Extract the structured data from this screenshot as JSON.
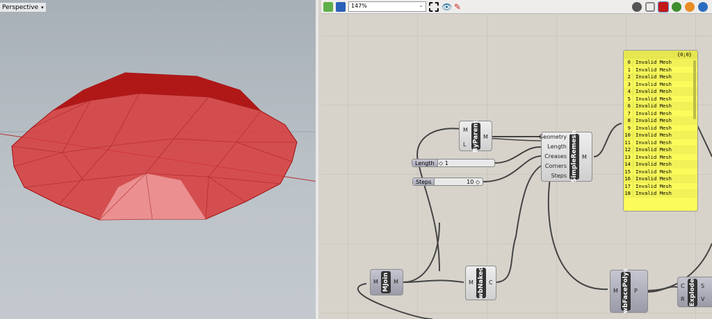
{
  "viewport": {
    "label": "Perspective",
    "mesh_color": "#d42020"
  },
  "toolbar": {
    "zoom": "147%"
  },
  "nodes": {
    "byparent": {
      "name": "ByParent",
      "inputs": [
        "M",
        "L"
      ],
      "outputs": [
        "M"
      ]
    },
    "simpleremesh": {
      "name": "SimpleRemesh",
      "inputs": [
        "Geometry",
        "Length",
        "Creases",
        "Corners",
        "Steps"
      ],
      "outputs": [
        "M"
      ]
    },
    "mjoin": {
      "name": "MJoin",
      "inputs": [
        "M"
      ],
      "outputs": [
        "M"
      ]
    },
    "wbnaked": {
      "name": "wbNaked",
      "inputs": [
        "M"
      ],
      "outputs": [
        "C"
      ]
    },
    "wbfacepolys": {
      "name": "wbFacePolys",
      "inputs": [
        "M"
      ],
      "outputs": [
        "P"
      ]
    },
    "explode": {
      "name": "Explode",
      "inputs": [
        "C",
        "R"
      ],
      "outputs": [
        "S",
        "V"
      ]
    }
  },
  "sliders": [
    {
      "label": "Length",
      "value": "◇ 1"
    },
    {
      "label": "Steps",
      "value": "10 ◇"
    }
  ],
  "panel": {
    "path": "{0;0}",
    "rows": [
      {
        "i": "0",
        "t": "Invalid Mesh"
      },
      {
        "i": "1",
        "t": "Invalid Mesh"
      },
      {
        "i": "2",
        "t": "Invalid Mesh"
      },
      {
        "i": "3",
        "t": "Invalid Mesh"
      },
      {
        "i": "4",
        "t": "Invalid Mesh"
      },
      {
        "i": "5",
        "t": "Invalid Mesh"
      },
      {
        "i": "6",
        "t": "Invalid Mesh"
      },
      {
        "i": "7",
        "t": "Invalid Mesh"
      },
      {
        "i": "8",
        "t": "Invalid Mesh"
      },
      {
        "i": "9",
        "t": "Invalid Mesh"
      },
      {
        "i": "10",
        "t": "Invalid Mesh"
      },
      {
        "i": "11",
        "t": "Invalid Mesh"
      },
      {
        "i": "12",
        "t": "Invalid Mesh"
      },
      {
        "i": "13",
        "t": "Invalid Mesh"
      },
      {
        "i": "14",
        "t": "Invalid Mesh"
      },
      {
        "i": "15",
        "t": "Invalid Mesh"
      },
      {
        "i": "16",
        "t": "Invalid Mesh"
      },
      {
        "i": "17",
        "t": "Invalid Mesh"
      },
      {
        "i": "18",
        "t": "Invalid Mesh"
      }
    ]
  }
}
